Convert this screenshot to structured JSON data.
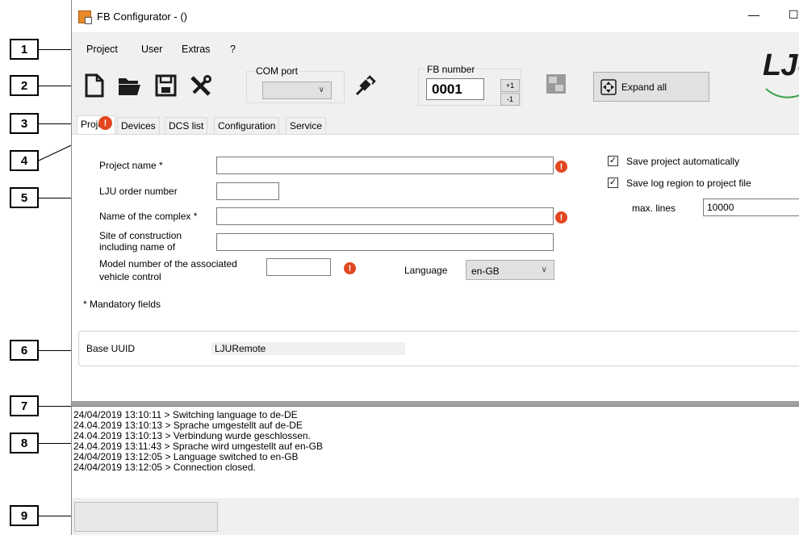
{
  "callouts": [
    "1",
    "2",
    "3",
    "4",
    "5",
    "6",
    "7",
    "8",
    "9"
  ],
  "window": {
    "title": "FB Configurator -  ()",
    "minimize_glyph": "—",
    "maximize_glyph": "☐"
  },
  "menu": {
    "items": [
      {
        "label": "Project"
      },
      {
        "label": "User"
      },
      {
        "label": "Extras"
      },
      {
        "label": "?"
      }
    ]
  },
  "toolbar": {
    "icons": [
      "new-file-icon",
      "open-folder-icon",
      "save-icon",
      "tools-icon"
    ],
    "com_port": {
      "title": "COM port",
      "value": ""
    },
    "connect_icon": "plug-connect-icon",
    "fb_number": {
      "title": "FB number",
      "value": "0001",
      "increment": "+1",
      "decrement": "-1"
    },
    "transfer_icon": "transfer-icon",
    "expand_all_label": "Expand all",
    "logo_text": "LJU"
  },
  "tabs": [
    {
      "label": "Proje",
      "active": true,
      "has_error": true
    },
    {
      "label": "Devices"
    },
    {
      "label": "DCS list"
    },
    {
      "label": "Configuration"
    },
    {
      "label": "Service"
    }
  ],
  "project_form": {
    "project_name_label": "Project name *",
    "project_name_value": "",
    "order_number_label": "LJU order number",
    "order_number_value": "",
    "complex_name_label": "Name of the complex *",
    "complex_name_value": "",
    "site_label_line1": "Site of construction",
    "site_label_line2": "including name of",
    "site_value": "",
    "model_label_line1": "Model number of the associated",
    "model_label_line2": "vehicle control",
    "model_value": "",
    "language_label": "Language",
    "language_value": "en-GB",
    "mandatory_note": "* Mandatory fields",
    "error_glyph": "!"
  },
  "options": {
    "save_auto_label": "Save project automatically",
    "save_auto_checked": true,
    "save_log_label": "Save log region to project file",
    "save_log_checked": true,
    "max_lines_label": "max. lines",
    "max_lines_value": "10000",
    "check_glyph": "✓"
  },
  "uuid": {
    "label": "Base UUID",
    "value": "LJURemote"
  },
  "log": {
    "lines": [
      "24/04/2019 13:10:11 > Switching language to de-DE",
      "24.04.2019 13:10:13 > Sprache umgestellt auf de-DE",
      "24.04.2019 13:10:13 > Verbindung wurde geschlossen.",
      "24.04.2019 13:11:43 > Sprache wird umgestellt auf en-GB",
      "24/04/2019 13:12:05 > Language switched to en-GB",
      "24/04/2019 13:12:05 > Connection closed."
    ]
  },
  "status": {
    "text": ""
  },
  "colors": {
    "error": "#e2461f",
    "logo": "#1a1a1a",
    "logo_swoosh": "#3aa14a",
    "icon": "#1b1b1b"
  }
}
